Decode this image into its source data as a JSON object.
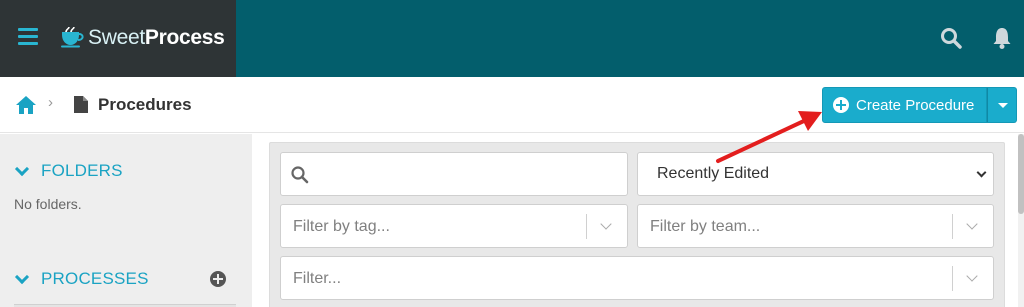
{
  "app": {
    "logo_thin": "Sweet",
    "logo_bold": "Process"
  },
  "header": {
    "icons": [
      "menu-icon",
      "search-icon",
      "bell-icon"
    ],
    "colors": {
      "bar": "#035e6c",
      "brand_bg": "#2e3436",
      "accent": "#1aaccc"
    }
  },
  "breadcrumb": {
    "home_icon": "home-icon",
    "page_icon": "document-icon",
    "title": "Procedures"
  },
  "actions": {
    "create_label": "Create Procedure"
  },
  "sidebar": {
    "folders_label": "FOLDERS",
    "folders_empty": "No folders.",
    "processes_label": "PROCESSES"
  },
  "filters": {
    "search_value": "",
    "sort_selected": "Recently Edited",
    "tag_placeholder": "Filter by tag...",
    "team_placeholder": "Filter by team...",
    "general_placeholder": "Filter..."
  },
  "annotation": {
    "arrow_color": "#e31e1e",
    "points_to": "create-procedure-button"
  }
}
